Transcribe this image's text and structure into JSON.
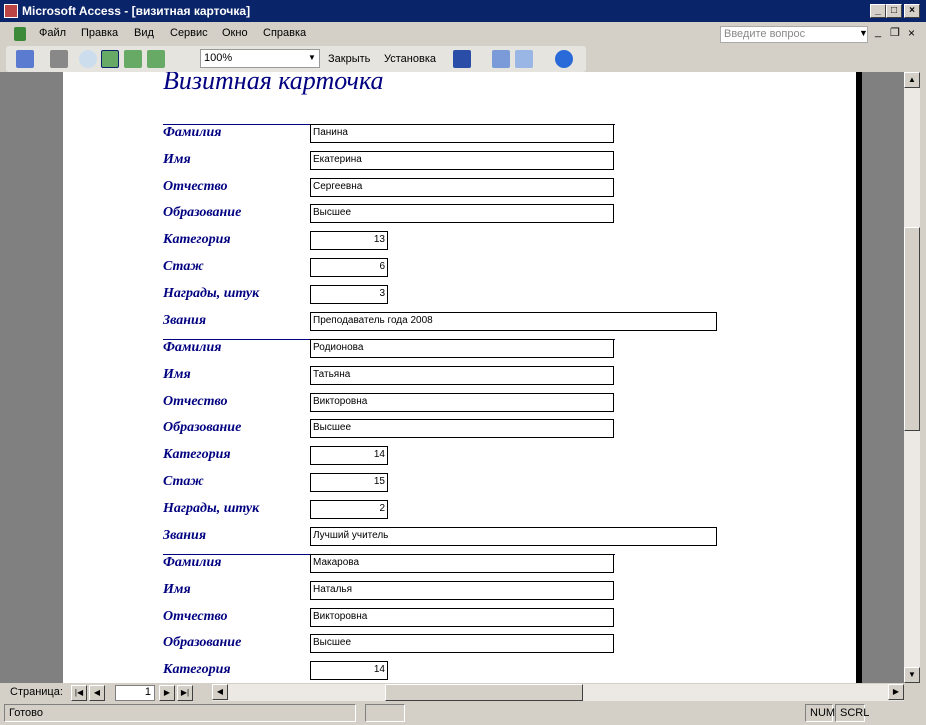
{
  "window": {
    "title": "Microsoft Access - [визитная карточка]"
  },
  "menu": [
    "Файл",
    "Правка",
    "Вид",
    "Сервис",
    "Окно",
    "Справка"
  ],
  "ask_placeholder": "Введите вопрос",
  "toolbar": {
    "zoom": "100%",
    "close": "Закрыть",
    "setup": "Установка"
  },
  "report": {
    "title": "Визитная карточка",
    "labels": [
      "Фамилия",
      "Имя",
      "Отчество",
      "Образование",
      "Категория",
      "Стаж",
      "Награды, штук",
      "Звания"
    ],
    "records": [
      [
        "Панина",
        "Екатерина",
        "Сергеевна",
        "Высшее",
        "13",
        "6",
        "3",
        "Преподаватель года 2008"
      ],
      [
        "Родионова",
        "Татьяна",
        "Викторовна",
        "Высшее",
        "14",
        "15",
        "2",
        "Лучший учитель"
      ],
      [
        "Макарова",
        "Наталья",
        "Викторовна",
        "Высшее",
        "14"
      ]
    ]
  },
  "nav": {
    "label": "Страница:",
    "page": "1"
  },
  "status": {
    "text": "Готово",
    "num": "NUM",
    "scrl": "SCRL"
  }
}
